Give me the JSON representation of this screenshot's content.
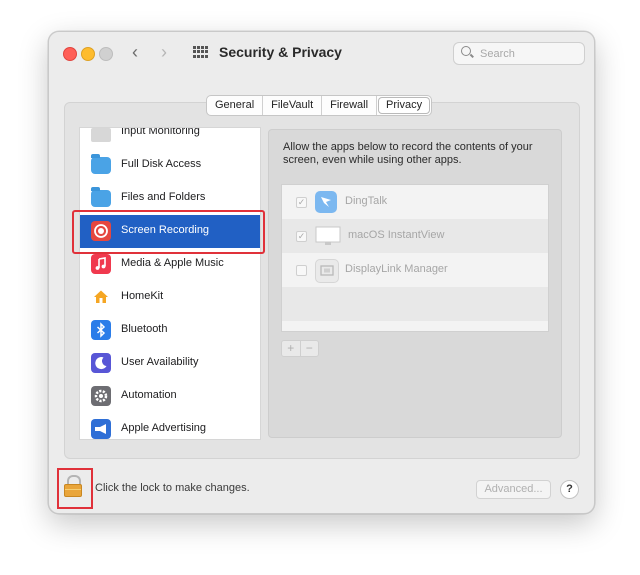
{
  "window": {
    "title": "Security & Privacy",
    "search_placeholder": "Search",
    "back_glyph": "‹",
    "forward_glyph": "›"
  },
  "tabs": [
    {
      "label": "General",
      "active": false
    },
    {
      "label": "FileVault",
      "active": false
    },
    {
      "label": "Firewall",
      "active": false
    },
    {
      "label": "Privacy",
      "active": true
    }
  ],
  "sidebar": {
    "items": [
      {
        "label": "Input Monitoring",
        "icon": "keyboard-icon"
      },
      {
        "label": "Full Disk Access",
        "icon": "folder-icon"
      },
      {
        "label": "Files and Folders",
        "icon": "folder-icon"
      },
      {
        "label": "Screen Recording",
        "icon": "screen-recording-icon",
        "selected": true
      },
      {
        "label": "Media & Apple Music",
        "icon": "music-icon"
      },
      {
        "label": "HomeKit",
        "icon": "home-icon"
      },
      {
        "label": "Bluetooth",
        "icon": "bluetooth-icon"
      },
      {
        "label": "User Availability",
        "icon": "moon-icon"
      },
      {
        "label": "Automation",
        "icon": "gear-icon"
      },
      {
        "label": "Apple Advertising",
        "icon": "megaphone-icon"
      }
    ]
  },
  "detail": {
    "description": "Allow the apps below to record the contents of your screen, even while using other apps.",
    "apps": [
      {
        "name": "DingTalk",
        "checked": true,
        "icon": "dingtalk-icon"
      },
      {
        "name": "macOS InstantView",
        "checked": true,
        "icon": "monitor-icon"
      },
      {
        "name": "DisplayLink Manager",
        "checked": false,
        "icon": "displaylink-icon"
      }
    ],
    "add_glyph": "+",
    "remove_glyph": "−"
  },
  "footer": {
    "lock_text": "Click the lock to make changes.",
    "advanced_label": "Advanced...",
    "help_label": "?"
  },
  "colors": {
    "selection": "#2160c4",
    "highlight": "#e0313a"
  }
}
